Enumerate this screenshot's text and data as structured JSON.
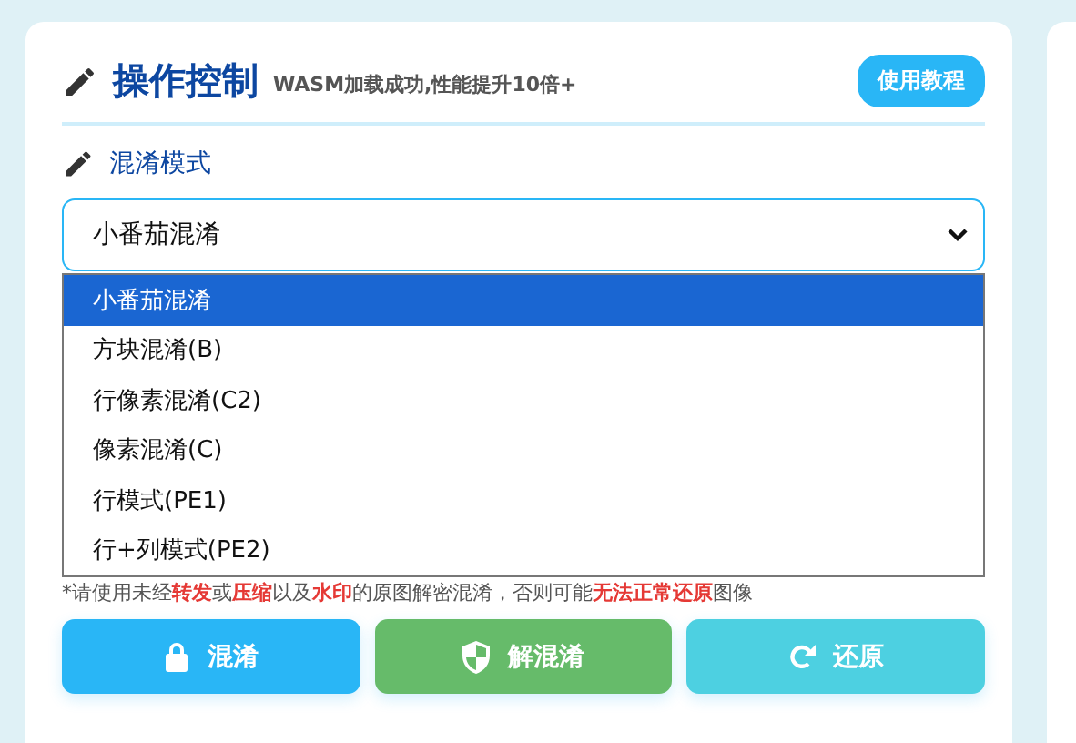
{
  "header": {
    "title": "操作控制",
    "status": "WASM加载成功,性能提升10倍+",
    "help_button": "使用教程"
  },
  "mode": {
    "label": "混淆模式",
    "value": "小番茄混淆",
    "options": [
      {
        "label": "小番茄混淆",
        "selected": true
      },
      {
        "label": "方块混淆(B)",
        "selected": false
      },
      {
        "label": "行像素混淆(C2)",
        "selected": false
      },
      {
        "label": "像素混淆(C)",
        "selected": false
      },
      {
        "label": "行模式(PE1)",
        "selected": false
      },
      {
        "label": "行+列模式(PE2)",
        "selected": false
      }
    ]
  },
  "hint": "*请使用未经**转发**或**压缩**以及**水印**的原图解密混淆，否则可能**无法正常还原**图像",
  "buttons": [
    {
      "label": "混淆",
      "kind": "lock",
      "color": "#29b6f6"
    },
    {
      "label": "解混淆",
      "kind": "shield",
      "color": "#66bb6a"
    },
    {
      "label": "还原",
      "kind": "reset",
      "color": "#4dd0e1"
    }
  ]
}
